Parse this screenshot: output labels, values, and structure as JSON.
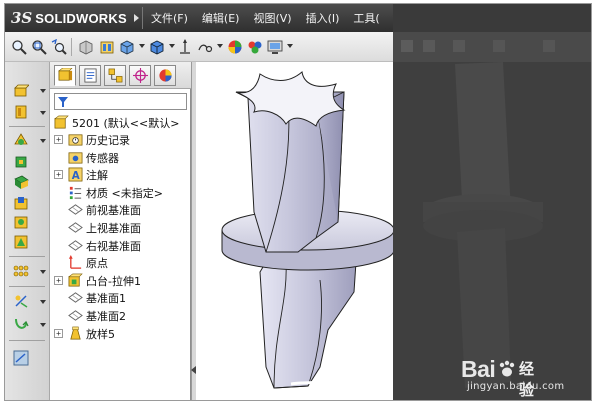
{
  "app": {
    "logo_ds": "3S",
    "logo_name": "SOLIDWORKS"
  },
  "menu": {
    "items": [
      "文件(F)",
      "编辑(E)",
      "视图(V)",
      "插入(I)",
      "工具("
    ]
  },
  "toolbar": {
    "icons": [
      "zoom-fit-icon",
      "zoom-area-icon",
      "previous-view-icon",
      "section-view-icon",
      "view-orientation-icon",
      "display-style-icon",
      "hide-show-icon",
      "edit-appearance-icon",
      "apply-scene-icon",
      "view-settings-icon"
    ]
  },
  "left_commandbar": {
    "icons": [
      "extruded-boss-icon",
      "revolved-boss-icon",
      "swept-boss-icon",
      "lofted-boss-icon",
      "boundary-boss-icon",
      "extruded-cut-icon",
      "hole-wizard-icon",
      "revolved-cut-icon",
      "linear-pattern-icon",
      "reference-geometry-icon",
      "curves-icon",
      "instant3d-icon"
    ]
  },
  "feature_manager": {
    "tabs": [
      "feature-manager-tab",
      "property-manager-tab",
      "configuration-manager-tab",
      "dimxpert-tab",
      "display-manager-tab"
    ],
    "part_name": "5201 (默认<<默认>",
    "items": [
      {
        "label": "历史记录",
        "icon": "history-folder-icon",
        "expandable": true
      },
      {
        "label": "传感器",
        "icon": "sensors-folder-icon",
        "expandable": false
      },
      {
        "label": "注解",
        "icon": "annotations-icon",
        "expandable": true
      },
      {
        "label": "材质 <未指定>",
        "icon": "material-icon",
        "expandable": false
      },
      {
        "label": "前视基准面",
        "icon": "plane-icon",
        "expandable": false
      },
      {
        "label": "上视基准面",
        "icon": "plane-icon",
        "expandable": false
      },
      {
        "label": "右视基准面",
        "icon": "plane-icon",
        "expandable": false
      },
      {
        "label": "原点",
        "icon": "origin-icon",
        "expandable": false
      },
      {
        "label": "凸台-拉伸1",
        "icon": "extrude-feature-icon",
        "expandable": true
      },
      {
        "label": "基准面1",
        "icon": "plane-icon",
        "expandable": false
      },
      {
        "label": "基准面2",
        "icon": "plane-icon",
        "expandable": false
      },
      {
        "label": "放样5",
        "icon": "loft-feature-icon",
        "expandable": true
      }
    ]
  },
  "watermark": {
    "brand": "Bai",
    "paw": "paw-icon",
    "brand_suffix": "经验",
    "url": "jingyan.baidu.com"
  }
}
